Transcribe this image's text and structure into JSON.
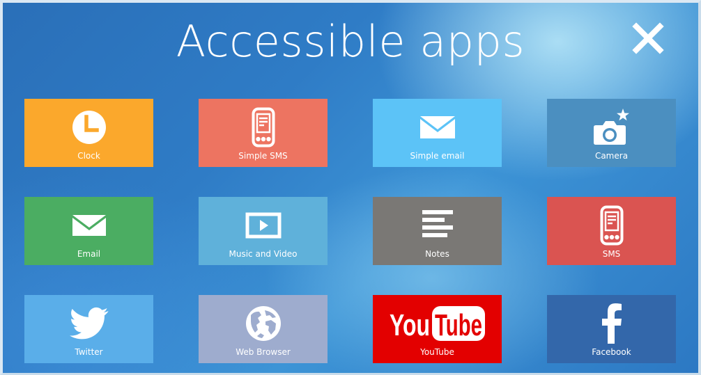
{
  "header": {
    "title": "Accessible apps",
    "close_icon": "close-x-icon"
  },
  "tiles": [
    {
      "label": "Clock",
      "icon": "clock-icon",
      "color": "#fba82c"
    },
    {
      "label": "Simple SMS",
      "icon": "phone-sms-icon",
      "color": "#ed7461"
    },
    {
      "label": "Simple email",
      "icon": "envelope-icon",
      "color": "#5cc3f7"
    },
    {
      "label": "Camera",
      "icon": "camera-icon",
      "color": "#4b8fc0"
    },
    {
      "label": "Email",
      "icon": "envelope-icon",
      "color": "#4bad62"
    },
    {
      "label": "Music and Video",
      "icon": "play-screen-icon",
      "color": "#5fb1da"
    },
    {
      "label": "Notes",
      "icon": "notes-lines-icon",
      "color": "#7a7875"
    },
    {
      "label": "SMS",
      "icon": "phone-sms-icon",
      "color": "#da5451"
    },
    {
      "label": "Twitter",
      "icon": "twitter-bird-icon",
      "color": "#5aaee9"
    },
    {
      "label": "Web Browser",
      "icon": "globe-icon",
      "color": "#9eacce"
    },
    {
      "label": "YouTube",
      "icon": "youtube-logo",
      "color": "#e30000",
      "logo_text": [
        "You",
        "Tube"
      ]
    },
    {
      "label": "Facebook",
      "icon": "facebook-f-icon",
      "color": "#3367aa"
    }
  ]
}
